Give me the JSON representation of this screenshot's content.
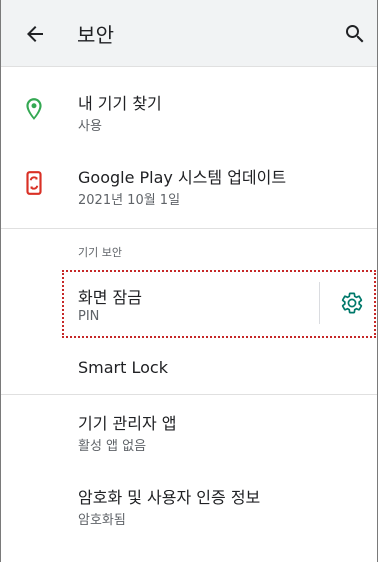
{
  "appbar": {
    "title": "보안",
    "back_icon": "arrow-back-icon",
    "search_icon": "search-icon"
  },
  "items": {
    "find_device": {
      "primary": "내 기기 찾기",
      "secondary": "사용",
      "icon": "location-pin-icon",
      "icon_color": "#34a853"
    },
    "system_update": {
      "primary": "Google Play 시스템 업데이트",
      "secondary": "2021년 10월 1일",
      "icon": "phone-update-icon",
      "icon_color": "#d93025"
    },
    "device_security_header": "기기 보안",
    "screen_lock": {
      "primary": "화면 잠금",
      "secondary": "PIN",
      "settings_icon": "gear-icon",
      "settings_icon_color": "#00796b"
    },
    "smart_lock": {
      "primary": "Smart Lock"
    },
    "device_admin": {
      "primary": "기기 관리자 앱",
      "secondary": "활성 앱 없음"
    },
    "encryption": {
      "primary": "암호화 및 사용자 인증 정보",
      "secondary": "암호화됨"
    }
  },
  "colors": {
    "appbar_bg": "#f1f3f4",
    "highlight_border": "#c62828",
    "divider": "#e0e0e0"
  }
}
